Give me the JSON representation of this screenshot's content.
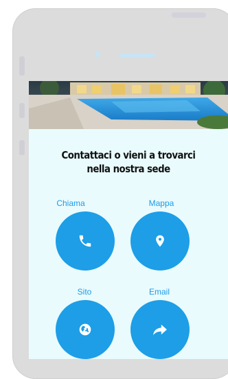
{
  "screen": {
    "heading_line1": "Contattaci o vieni a trovarci",
    "heading_line2": "nella nostra sede"
  },
  "actions": [
    {
      "label": "Chiama",
      "icon": "phone-icon"
    },
    {
      "label": "Mappa",
      "icon": "map-pin-icon"
    },
    {
      "label": "Sito",
      "icon": "globe-icon"
    },
    {
      "label": "Email",
      "icon": "share-arrow-icon"
    }
  ],
  "colors": {
    "accent": "#1d9ee7",
    "screen_background": "#e9fbfd",
    "device_body": "#dcdcdc"
  }
}
